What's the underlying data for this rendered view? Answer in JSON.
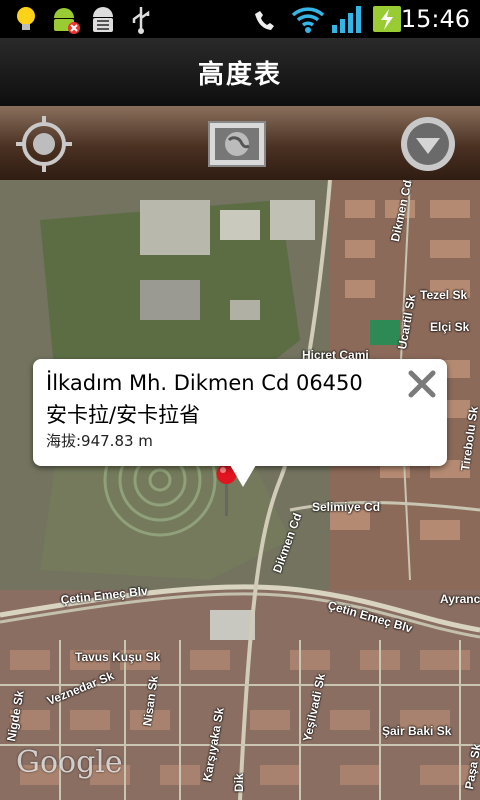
{
  "status_bar": {
    "icons": [
      "bulb-icon",
      "android-debug-icon",
      "android-bug-icon",
      "usb-icon",
      "missed-call-icon",
      "wifi-icon",
      "signal-icon",
      "battery-icon"
    ],
    "time": "15:46"
  },
  "title_bar": {
    "title": "高度表"
  },
  "toolbar": {
    "buttons": [
      "locate-icon",
      "map-view-icon",
      "dropdown-menu-icon"
    ]
  },
  "map": {
    "road_labels": {
      "dikmen_cd_top": "Dikmen Cd",
      "tezel_sk": "Tezel Sk",
      "elci_sk": "Elçi Sk",
      "hicret_cami": "Hicret Cami",
      "ucartil_sk": "Ucartil Sk",
      "tirebolu_sk": "Tirebolu Sk",
      "selimiye_cd": "Selimiye Cd",
      "dikmen_cd_mid": "Dikmen Cd",
      "cetin_emec_left": "Çetin Emeç Blv",
      "cetin_emec_right": "Çetin Emeç Blv",
      "ayranci": "Ayranc",
      "tavus_kusu_sk": "Tavus Kuşu Sk",
      "veznedar_sk": "Veznedar Sk",
      "nigde_sk": "Nigde Sk",
      "nisan_sk": "Nisan Sk",
      "karsiyaka_sk": "Karşıyaka Sk",
      "yesilvadi_sk": "Yeşilvadi Sk",
      "sair_baki_sk": "Şair Baki Sk",
      "dik_bottom": "Dik",
      "pasa_sk": "Paşa Sk"
    },
    "google_logo": "Google"
  },
  "callout": {
    "address_line1": "İlkadım Mh. Dikmen Cd 06450",
    "address_line2": "安卡拉/安卡拉省",
    "altitude": "海拔:947.83 m"
  }
}
